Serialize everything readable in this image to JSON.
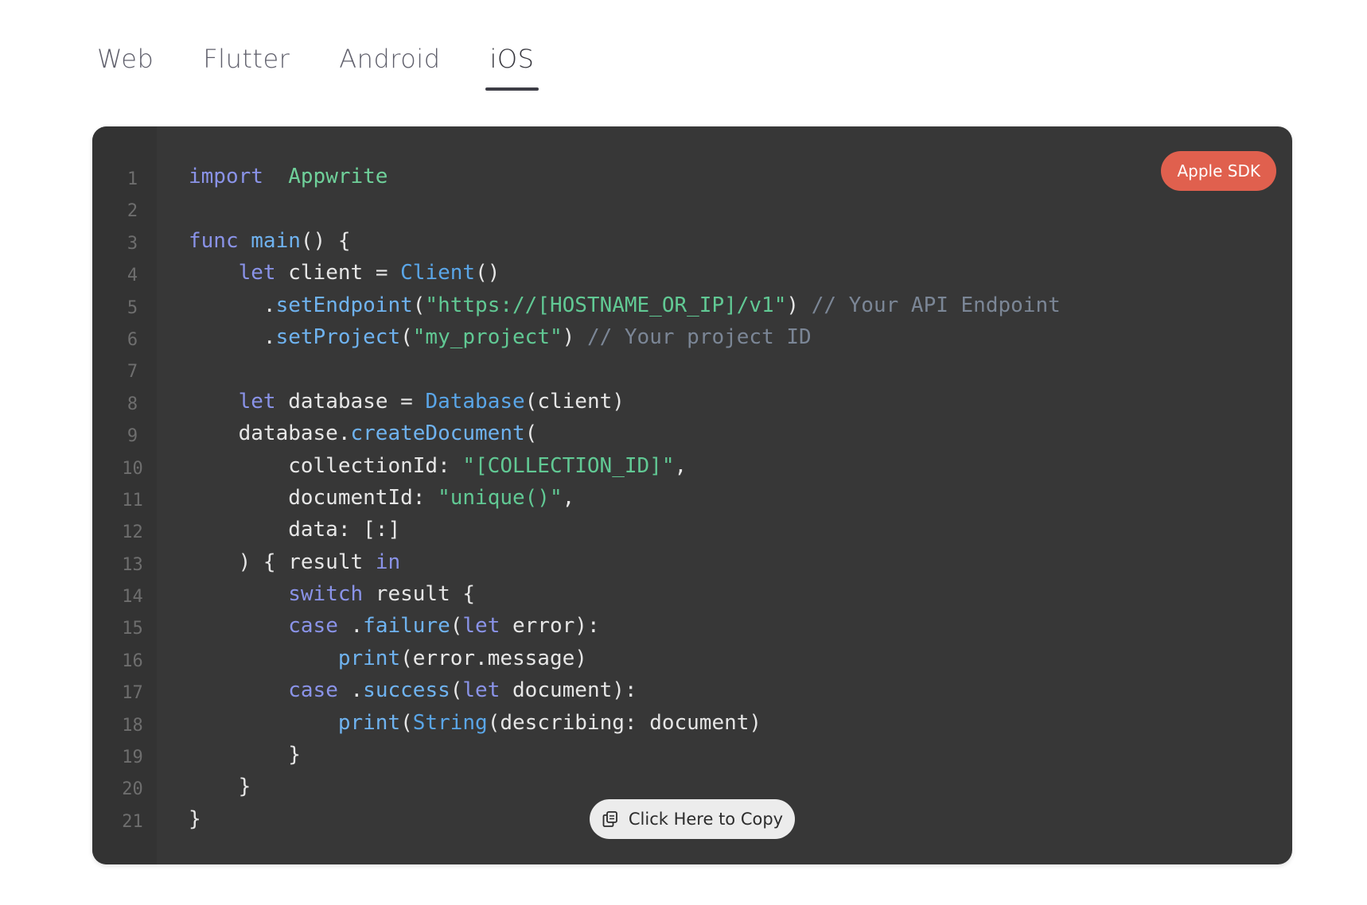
{
  "tabs": [
    {
      "label": "Web",
      "active": false
    },
    {
      "label": "Flutter",
      "active": false
    },
    {
      "label": "Android",
      "active": false
    },
    {
      "label": "iOS",
      "active": true
    }
  ],
  "badge": {
    "label": "Apple SDK",
    "color": "#e0604e"
  },
  "copy_button": {
    "label": "Click Here to Copy",
    "icon": "copy-icon"
  },
  "code": {
    "language": "swift",
    "line_numbers": [
      "1",
      "2",
      "3",
      "4",
      "5",
      "6",
      "7",
      "8",
      "9",
      "10",
      "11",
      "12",
      "13",
      "14",
      "15",
      "16",
      "17",
      "18",
      "19",
      "20",
      "21"
    ],
    "lines": [
      [
        [
          "k",
          "import"
        ],
        [
          "",
          "  "
        ],
        [
          "mod",
          "Appwrite"
        ]
      ],
      [],
      [
        [
          "k",
          "func"
        ],
        [
          "",
          " "
        ],
        [
          "m",
          "main"
        ],
        [
          "",
          "() {"
        ]
      ],
      [
        [
          "",
          "    "
        ],
        [
          "k",
          "let"
        ],
        [
          "",
          " client = "
        ],
        [
          "t",
          "Client"
        ],
        [
          "",
          "()"
        ]
      ],
      [
        [
          "",
          "      ."
        ],
        [
          "m",
          "setEndpoint"
        ],
        [
          "",
          "("
        ],
        [
          "s",
          "\"https://[HOSTNAME_OR_IP]/v1\""
        ],
        [
          "",
          ") "
        ],
        [
          "c",
          "// Your API Endpoint"
        ]
      ],
      [
        [
          "",
          "      ."
        ],
        [
          "m",
          "setProject"
        ],
        [
          "",
          "("
        ],
        [
          "s",
          "\"my_project\""
        ],
        [
          "",
          ") "
        ],
        [
          "c",
          "// Your project ID"
        ]
      ],
      [],
      [
        [
          "",
          "    "
        ],
        [
          "k",
          "let"
        ],
        [
          "",
          " database = "
        ],
        [
          "t",
          "Database"
        ],
        [
          "",
          "(client)"
        ]
      ],
      [
        [
          "",
          "    database."
        ],
        [
          "m",
          "createDocument"
        ],
        [
          "",
          "("
        ]
      ],
      [
        [
          "",
          "        collectionId: "
        ],
        [
          "s",
          "\"[COLLECTION_ID]\""
        ],
        [
          "",
          ","
        ]
      ],
      [
        [
          "",
          "        documentId: "
        ],
        [
          "s",
          "\"unique()\""
        ],
        [
          "",
          ","
        ]
      ],
      [
        [
          "",
          "        data: [:]"
        ]
      ],
      [
        [
          "",
          "    ) { result "
        ],
        [
          "k",
          "in"
        ]
      ],
      [
        [
          "",
          "        "
        ],
        [
          "k",
          "switch"
        ],
        [
          "",
          " result {"
        ]
      ],
      [
        [
          "",
          "        "
        ],
        [
          "k",
          "case"
        ],
        [
          "",
          " ."
        ],
        [
          "m",
          "failure"
        ],
        [
          "",
          "("
        ],
        [
          "k",
          "let"
        ],
        [
          "",
          " error):"
        ]
      ],
      [
        [
          "",
          "            "
        ],
        [
          "m",
          "print"
        ],
        [
          "",
          "(error.message)"
        ]
      ],
      [
        [
          "",
          "        "
        ],
        [
          "k",
          "case"
        ],
        [
          "",
          " ."
        ],
        [
          "m",
          "success"
        ],
        [
          "",
          "("
        ],
        [
          "k",
          "let"
        ],
        [
          "",
          " document):"
        ]
      ],
      [
        [
          "",
          "            "
        ],
        [
          "m",
          "print"
        ],
        [
          "",
          "("
        ],
        [
          "t",
          "String"
        ],
        [
          "",
          "(describing: document)"
        ]
      ],
      [
        [
          "",
          "        }"
        ]
      ],
      [
        [
          "",
          "    }"
        ]
      ],
      [
        [
          "",
          "}"
        ]
      ]
    ]
  }
}
